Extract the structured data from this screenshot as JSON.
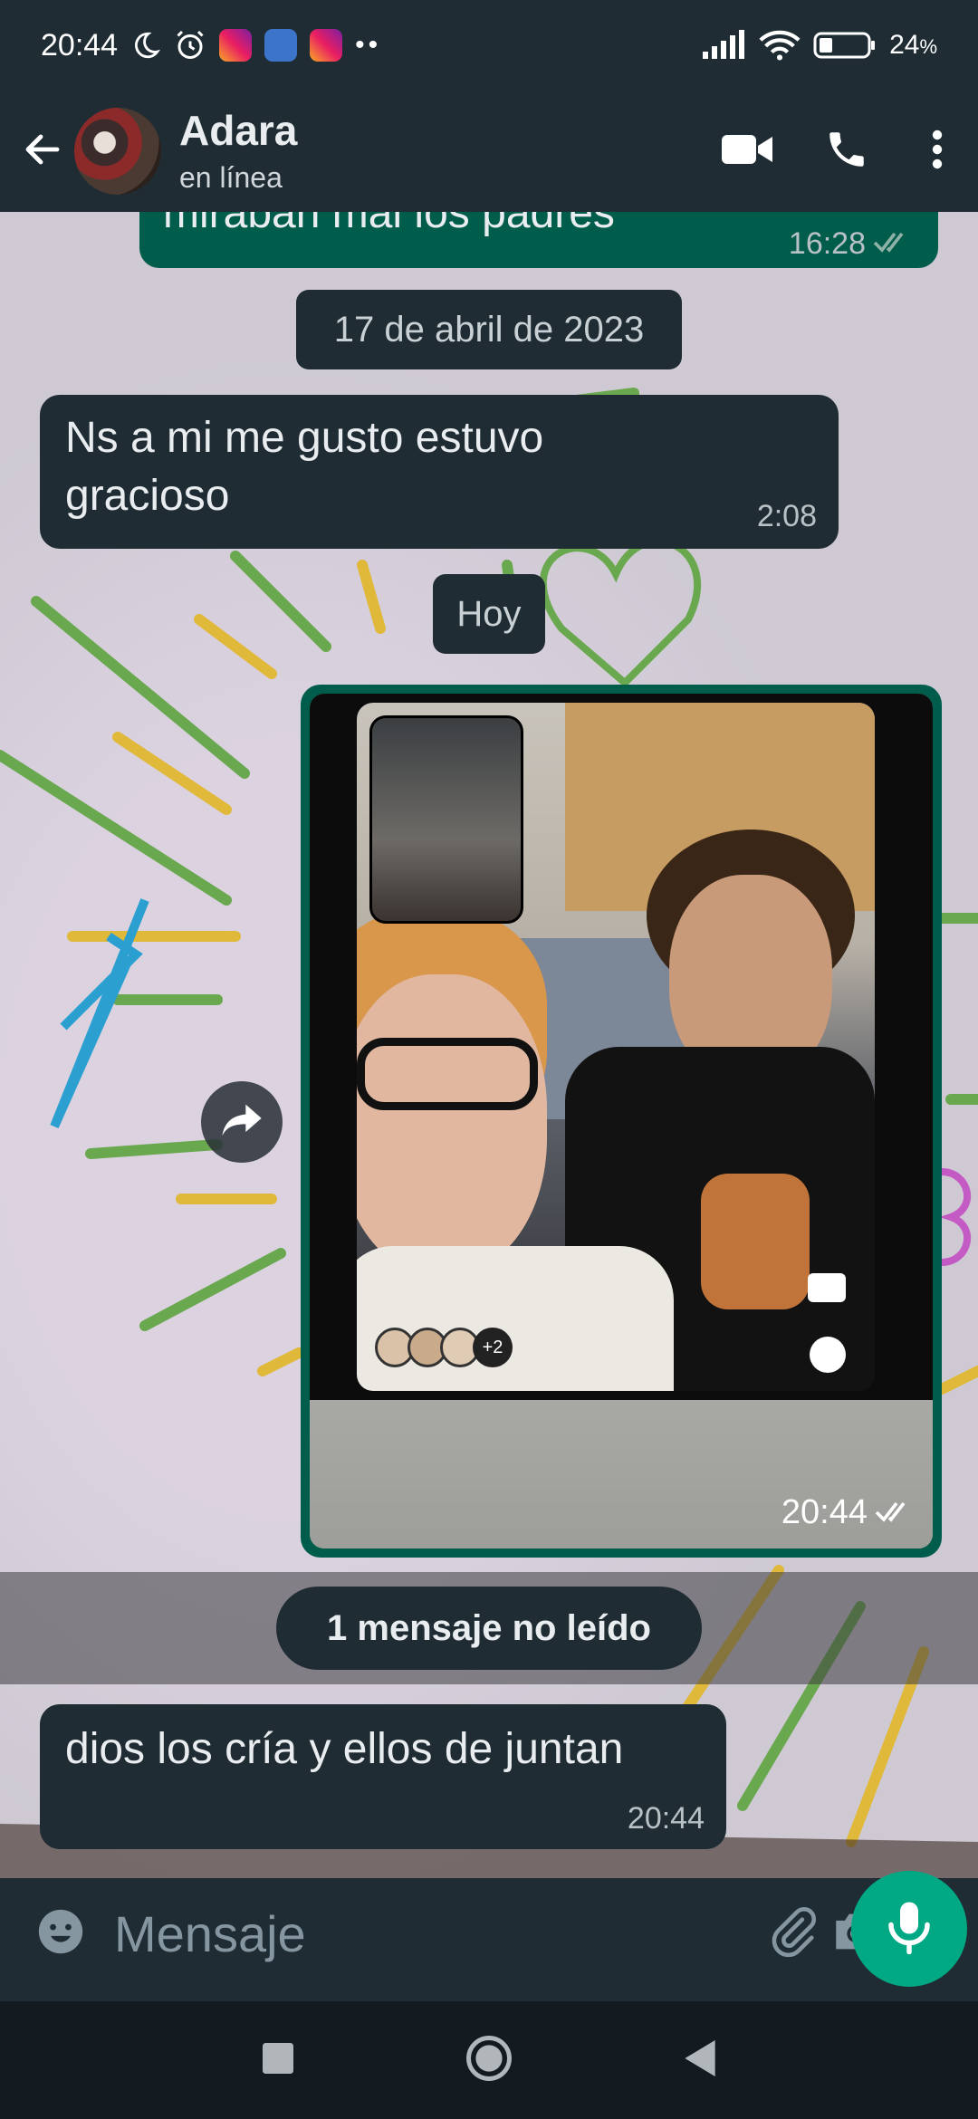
{
  "status_bar": {
    "time": "20:44",
    "battery": "24",
    "battery_unit": "%"
  },
  "header": {
    "contact_name": "Adara",
    "contact_status": "en línea"
  },
  "messages": {
    "partial_out": {
      "text": "mirabán mal los padres",
      "time": "16:28"
    },
    "date_chip_1": "17 de abril de 2023",
    "in_1": {
      "text": "Ns a mi me gusto estuvo gracioso",
      "time": "2:08"
    },
    "date_chip_2": "Hoy",
    "image_msg": {
      "time": "20:44",
      "participants_more": "+2"
    },
    "unread_label": "1 mensaje no leído",
    "in_2": {
      "text": "dios los cría y ellos de juntan",
      "time": "20:44"
    }
  },
  "composer": {
    "placeholder": "Mensaje"
  },
  "icons": {
    "back": "arrow-left-icon",
    "video": "video-camera-icon",
    "call": "phone-icon",
    "menu": "more-vertical-icon",
    "emoji": "emoji-icon",
    "attach": "paperclip-icon",
    "camera": "camera-icon",
    "mic": "microphone-icon",
    "forward": "forward-icon"
  },
  "colors": {
    "app_bar": "#1f2c34",
    "outgoing_bubble": "#005c4b",
    "incoming_bubble": "#1f2c34",
    "accent": "#00a884"
  }
}
